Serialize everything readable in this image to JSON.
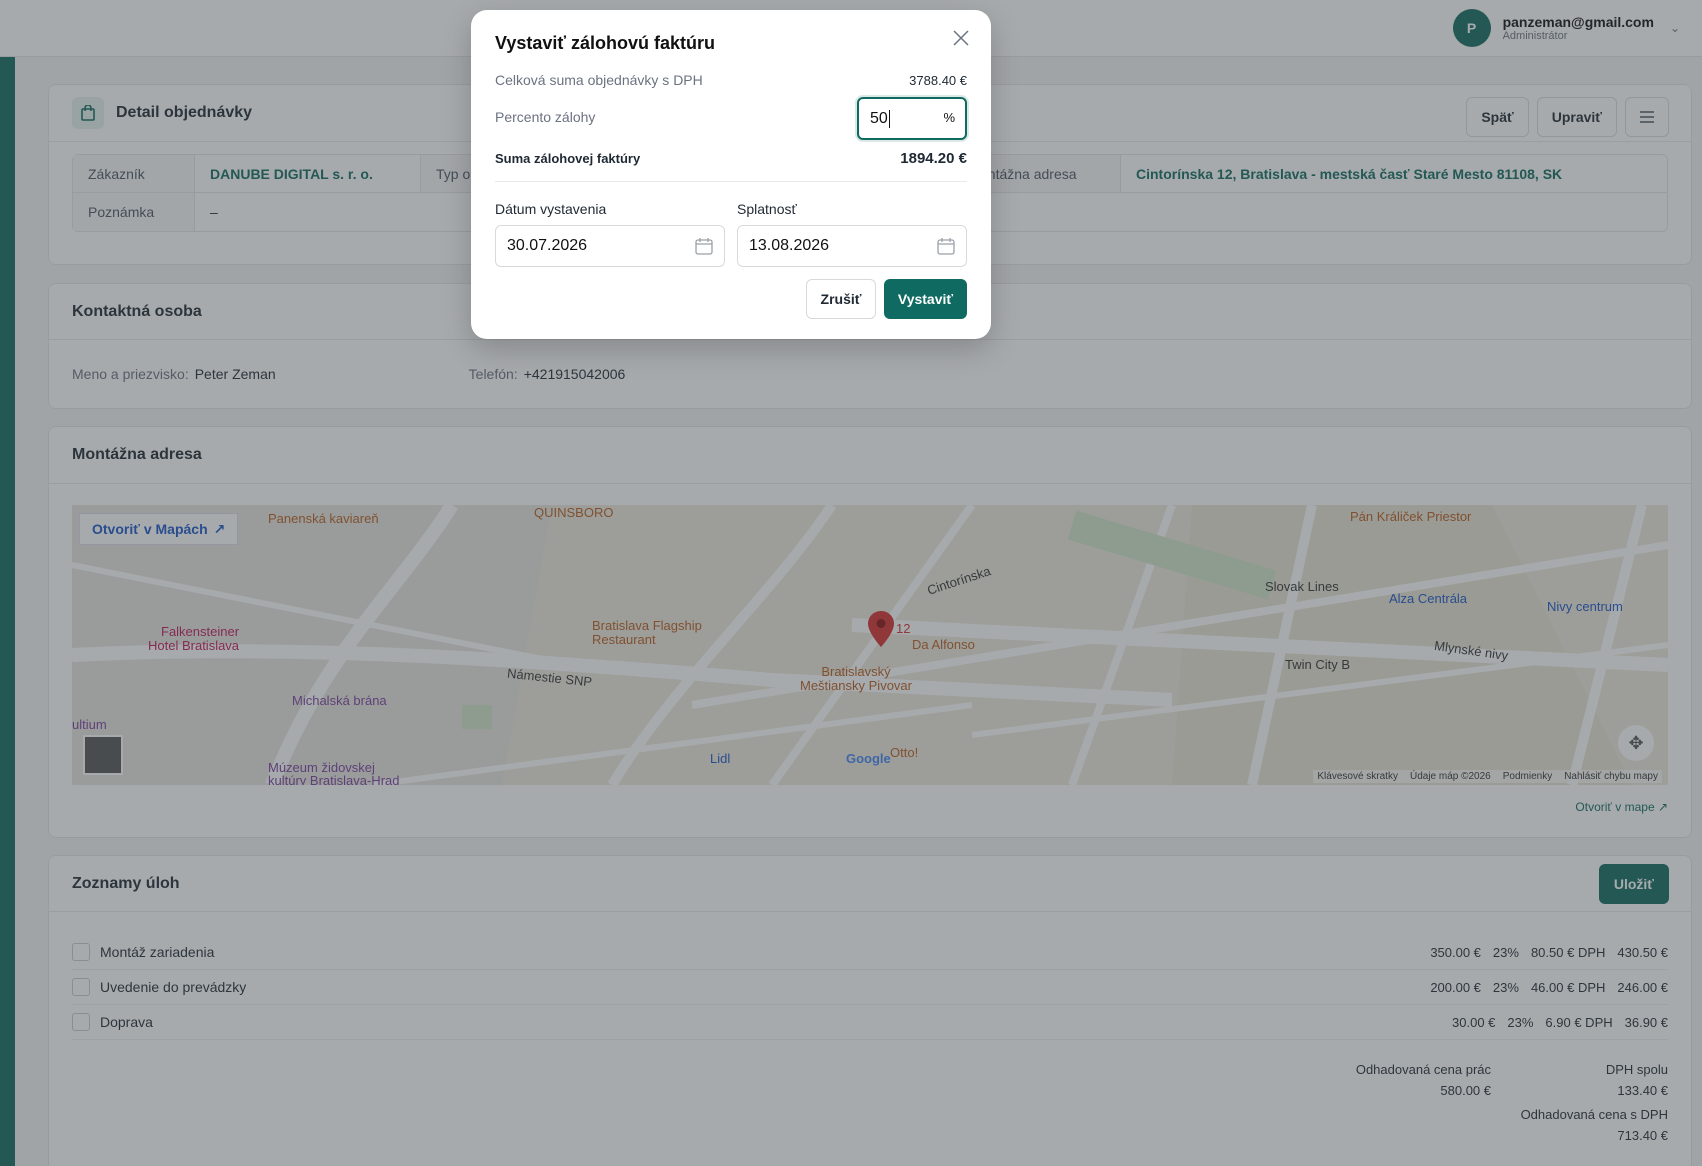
{
  "user": {
    "initial": "P",
    "email": "panzeman@gmail.com",
    "role": "Administrátor"
  },
  "order": {
    "title": "Detail objednávky",
    "buttons": {
      "back": "Späť",
      "edit": "Upraviť"
    },
    "customer_label": "Zákazník",
    "customer_value": "DANUBE DIGITAL s. r. o.",
    "type_label": "Typ ob",
    "note_label": "Poznámka",
    "note_value": "–",
    "address_label": "ontážna adresa",
    "address_value": "Cintorínska 12, Bratislava - mestská časť Staré Mesto 81108, SK"
  },
  "contact": {
    "title": "Kontaktná osoba",
    "name_label": "Meno a priezvisko:",
    "name_value": "Peter Zeman",
    "phone_label": "Telefón:",
    "phone_value": "+421915042006"
  },
  "address": {
    "title": "Montážna adresa",
    "open_maps": "Otvoriť v Mapách",
    "open_in_map": "Otvoriť v mape ↗",
    "map_labels": {
      "panenska": "Panenská kaviareň",
      "quinsboro": "QUINSBORO",
      "falkensteiner": "Falkensteiner\nHotel Bratislava",
      "flagship": "Bratislava Flagship\nRestaurant",
      "michalska": "Michalská brána",
      "mestiansky": "Bratislavský\nMeštiansky Pivovar",
      "alfonso": "Da Alfonso",
      "cintorinska": "Cintorínska",
      "namestie": "Námestie SNP",
      "slovak_lines": "Slovak Lines",
      "alza": "Alza Centrála",
      "nivy": "Nivy centrum",
      "twin_city": "Twin City B",
      "kralicek": "Pán Králiček Priestor",
      "mlynske": "Mlynské nivy",
      "lidl": "Lidl",
      "otto": "Otto!",
      "pin_num": "12",
      "zidovskej": "Múzeum židovskej\nkultúry Bratislava-Hrad",
      "ultium": "ultium",
      "google": "Google"
    },
    "map_footer": [
      "Klávesové skratky",
      "Údaje máp ©2026",
      "Podmienky",
      "Nahlásiť chybu mapy"
    ]
  },
  "tasks": {
    "title": "Zoznamy úloh",
    "save": "Uložiť",
    "items": [
      {
        "name": "Montáž zariadenia",
        "price": "350.00 €",
        "vat": "23%",
        "vat_amount": "80.50 € DPH",
        "total": "430.50 €"
      },
      {
        "name": "Uvedenie do prevádzky",
        "price": "200.00 €",
        "vat": "23%",
        "vat_amount": "46.00 € DPH",
        "total": "246.00 €"
      },
      {
        "name": "Doprava",
        "price": "30.00 €",
        "vat": "23%",
        "vat_amount": "6.90 € DPH",
        "total": "36.90 €"
      }
    ],
    "est_label": "Odhadovaná cena prác",
    "est_value": "580.00 €",
    "vat_label": "DPH spolu",
    "vat_value": "133.40 €",
    "est_vat_label": "Odhadovaná cena s DPH",
    "est_vat_value": "713.40 €"
  },
  "modal": {
    "title": "Vystaviť zálohovú faktúru",
    "total_label": "Celková suma objednávky s DPH",
    "total_value": "3788.40 €",
    "percent_label": "Percento zálohy",
    "percent_value": "50",
    "percent_unit": "%",
    "sum_label": "Suma zálohovej faktúry",
    "sum_value": "1894.20 €",
    "issue_date_label": "Dátum vystavenia",
    "issue_date_value": "30.07.2026",
    "due_label": "Splatnosť",
    "due_value": "13.08.2026",
    "cancel": "Zrušiť",
    "submit": "Vystaviť"
  }
}
